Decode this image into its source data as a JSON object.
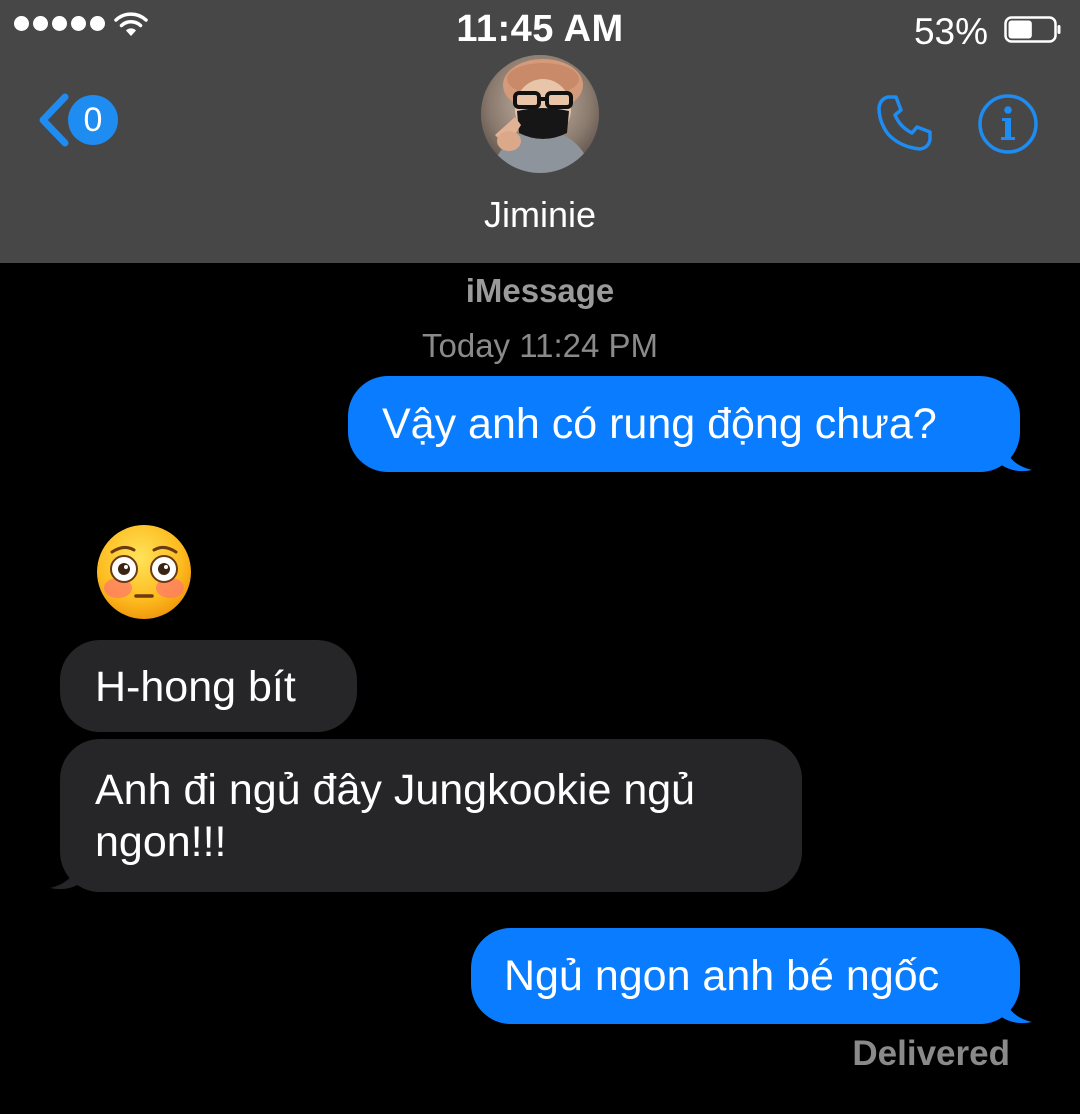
{
  "status_bar": {
    "time": "11:45 AM",
    "battery_percent": "53%",
    "battery_level": 0.53,
    "signal_bars": 5
  },
  "nav": {
    "back_badge": "0",
    "contact_name": "Jiminie",
    "icons": [
      "chevron-left-icon",
      "phone-icon",
      "info-icon"
    ]
  },
  "conversation": {
    "service": "iMessage",
    "timestamp": "Today 11:24 PM",
    "messages": [
      {
        "direction": "outgoing",
        "text": "Vậy anh có rung động chưa?"
      },
      {
        "direction": "incoming",
        "text": "😳"
      },
      {
        "direction": "incoming",
        "text": "H-hong bít"
      },
      {
        "direction": "incoming",
        "text": "Anh đi ngủ đây Jungkookie ngủ ngon!!!"
      },
      {
        "direction": "outgoing",
        "text": "Ngủ ngon anh bé ngốc"
      }
    ],
    "delivery_status": "Delivered"
  },
  "colors": {
    "header_bg": "#474747",
    "background": "#000000",
    "outgoing_bubble": "#0a7cff",
    "incoming_bubble": "#262628",
    "accent": "#1e8cf0"
  }
}
